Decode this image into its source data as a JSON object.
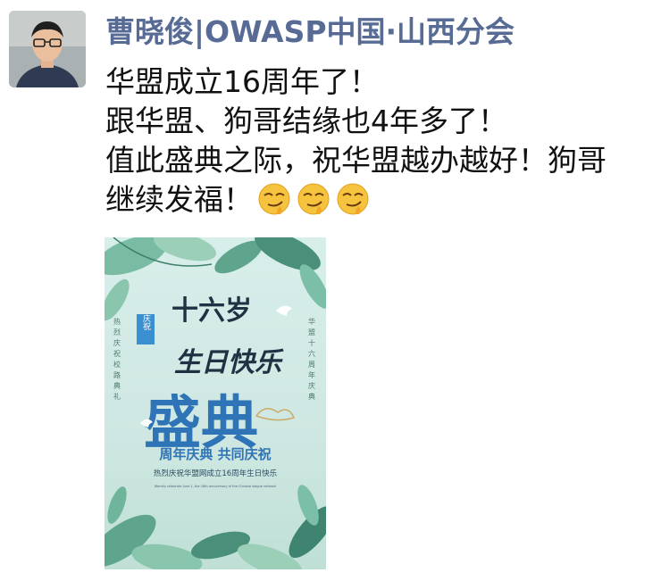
{
  "post": {
    "author": "曹晓俊|OWASP中国·山西分会",
    "lines": [
      "华盟成立16周年了！",
      "跟华盟、狗哥结缘也4年多了！",
      "值此盛典之际，祝华盟越办越好！狗哥",
      "继续发福！"
    ],
    "emojis": [
      "smirk-emoji",
      "smirk-emoji",
      "smirk-emoji"
    ]
  },
  "poster": {
    "badge": "庆祝",
    "title_top": "十六岁",
    "title_script": "生日快乐",
    "title_big": "盛典",
    "subtitle": "周年庆典 共同庆祝",
    "caption": "热烈庆祝华盟网成立16周年生日快乐",
    "english_line": "Warmly celebrate June 1, the 16th anniversary of the Chinese league network",
    "left_vertical": "热烈庆祝校路典礼",
    "right_vertical": "华盟十六周年庆典",
    "colors": {
      "sky": "#cfe7e2",
      "leaf": "#5fa58e",
      "title": "#2f74b6",
      "script": "#1f3142"
    }
  }
}
